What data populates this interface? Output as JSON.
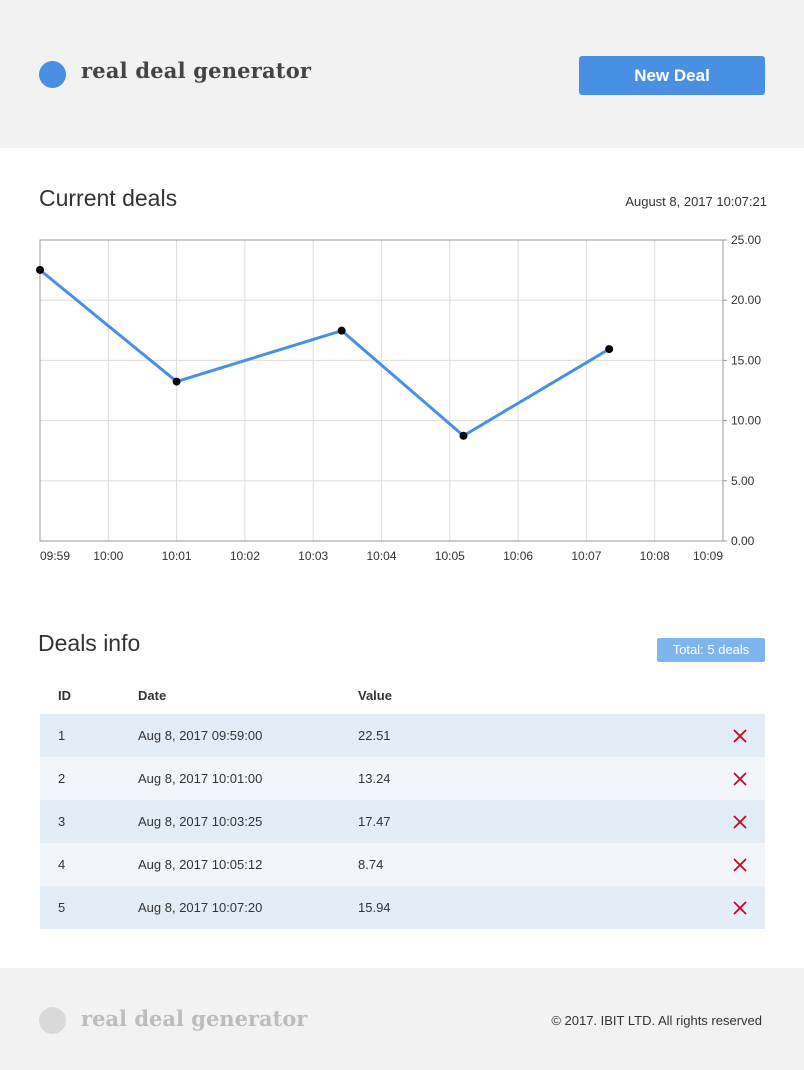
{
  "header": {
    "logo_text": "real deal generator",
    "new_deal_label": "New Deal",
    "accent_color": "#4a90e2"
  },
  "current_deals": {
    "title": "Current deals",
    "timestamp": "August 8, 2017 10:07:21"
  },
  "chart_data": {
    "type": "line",
    "x_ticks": [
      "09:59",
      "10:00",
      "10:01",
      "10:02",
      "10:03",
      "10:04",
      "10:05",
      "10:06",
      "10:07",
      "10:08",
      "10:09"
    ],
    "y_ticks": [
      "0.00",
      "5.00",
      "10.00",
      "15.00",
      "20.00",
      "25.00"
    ],
    "ylim": [
      0,
      25
    ],
    "xlim": [
      "09:59:00",
      "10:09:00"
    ],
    "grid": true,
    "y_axis_side": "right",
    "line_color": "#4a90e2",
    "points": [
      {
        "x": "09:59:00",
        "y": 22.51
      },
      {
        "x": "10:01:00",
        "y": 13.24
      },
      {
        "x": "10:03:25",
        "y": 17.47
      },
      {
        "x": "10:05:12",
        "y": 8.74
      },
      {
        "x": "10:07:20",
        "y": 15.94
      }
    ]
  },
  "deals_info": {
    "title": "Deals info",
    "total_label": "Total: 5 deals",
    "columns": [
      "ID",
      "Date",
      "Value"
    ],
    "rows": [
      {
        "id": "1",
        "date": "Aug 8, 2017 09:59:00",
        "value": "22.51"
      },
      {
        "id": "2",
        "date": "Aug 8, 2017 10:01:00",
        "value": "13.24"
      },
      {
        "id": "3",
        "date": "Aug 8, 2017 10:03:25",
        "value": "17.47"
      },
      {
        "id": "4",
        "date": "Aug 8, 2017 10:05:12",
        "value": "8.74"
      },
      {
        "id": "5",
        "date": "Aug 8, 2017 10:07:20",
        "value": "15.94"
      }
    ],
    "delete_icon": "close-x-icon",
    "delete_color": "#d0021b"
  },
  "footer": {
    "logo_text": "real deal generator",
    "copyright": "© 2017. IBIT LTD. All rights reserved"
  }
}
